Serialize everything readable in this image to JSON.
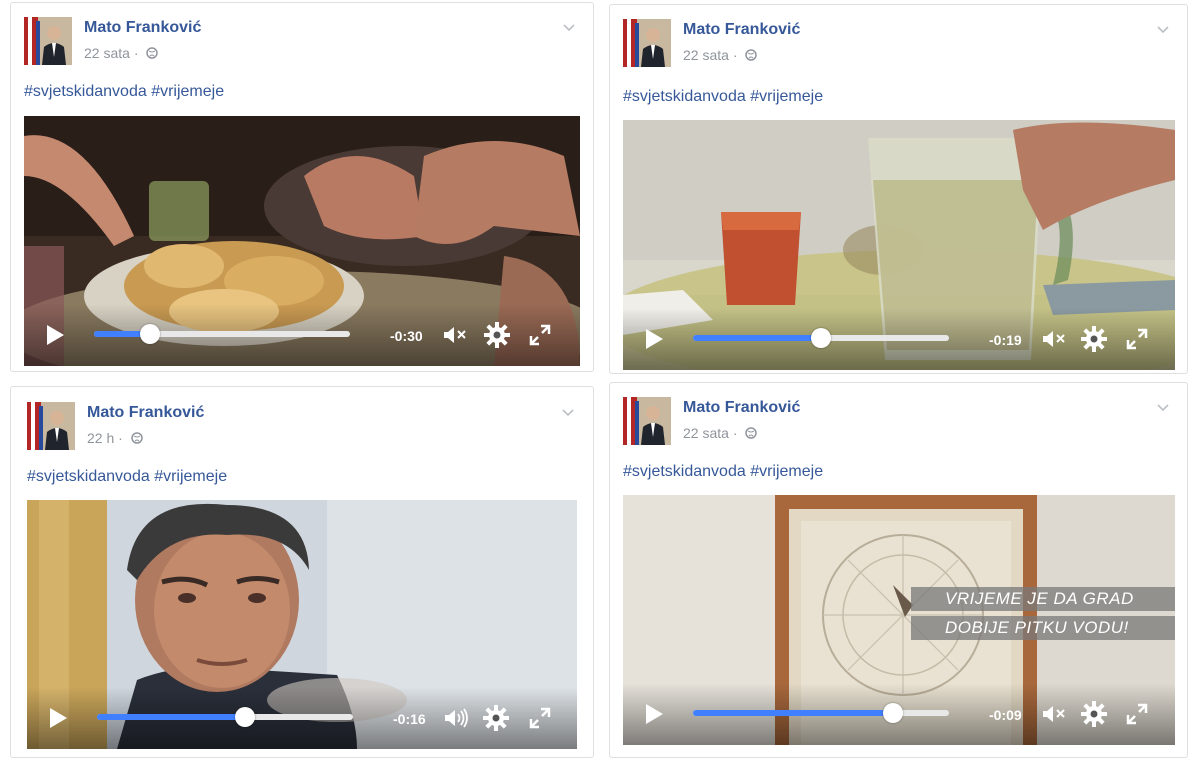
{
  "posts": [
    {
      "author": "Mato Franković",
      "time": "22 sata",
      "separator": "·",
      "hashtags": "#svjetskidanvoda #vrijemeje",
      "video": {
        "remaining": "-0:30",
        "progress": 0.22,
        "muted": true,
        "scene": "hands-food"
      }
    },
    {
      "author": "Mato Franković",
      "time": "22 sata",
      "separator": "·",
      "hashtags": "#svjetskidanvoda #vrijemeje",
      "video": {
        "remaining": "-0:19",
        "progress": 0.5,
        "muted": true,
        "scene": "water-jug"
      }
    },
    {
      "author": "Mato Franković",
      "time": "22 h",
      "separator": "·",
      "hashtags": "#svjetskidanvoda #vrijemeje",
      "video": {
        "remaining": "-0:16",
        "progress": 0.58,
        "muted": false,
        "scene": "man-portrait"
      }
    },
    {
      "author": "Mato Franković",
      "time": "22 sata",
      "separator": "·",
      "hashtags": "#svjetskidanvoda #vrijemeje",
      "video": {
        "remaining": "-0:09",
        "progress": 0.78,
        "muted": true,
        "scene": "clock",
        "caption_line1": "VRIJEME JE DA GRAD",
        "caption_line2": "DOBIJE PITKU VODU!"
      }
    }
  ],
  "colors": {
    "author": "#365899",
    "hashtag": "#365899",
    "progress": "#4080ff",
    "meta": "#90949c"
  },
  "icons": [
    "play-icon",
    "volume-muted-icon",
    "volume-icon",
    "gear-icon",
    "fullscreen-icon",
    "globe-icon",
    "chevron-down-icon"
  ]
}
